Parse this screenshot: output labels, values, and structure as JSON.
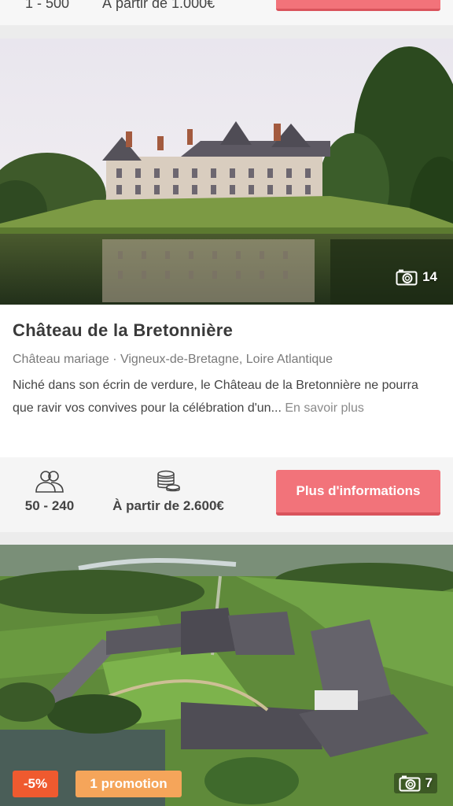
{
  "prev_card": {
    "guests_partial": "1 - 500",
    "price_partial": "À partir de 1.000€"
  },
  "venues": [
    {
      "title": "Château de la Bretonnière",
      "category": "Château mariage",
      "location": "Vigneux-de-Bretagne, Loire Atlantique",
      "subtitle": "Château mariage · Vigneux-de-Bretagne, Loire Atlantique",
      "description": "Niché dans son écrin de verdure, le Château de la Bretonnière ne pourra que ravir vos convives pour la célébration d'un...",
      "read_more": "En savoir plus",
      "photo_count": "14",
      "guests": "50 - 240",
      "price": "À partir de 2.600€",
      "cta_label": "Plus d'informations"
    },
    {
      "photo_count": "7",
      "discount_badge": "-5%",
      "promo_badge": "1 promotion"
    }
  ],
  "icons": {
    "camera": "camera-icon",
    "guests": "people-icon",
    "price": "coins-icon"
  },
  "colors": {
    "cta": "#f2737a",
    "cta_shadow": "#d9545c",
    "discount": "#ef5a2f",
    "promo": "#f5a55a"
  }
}
